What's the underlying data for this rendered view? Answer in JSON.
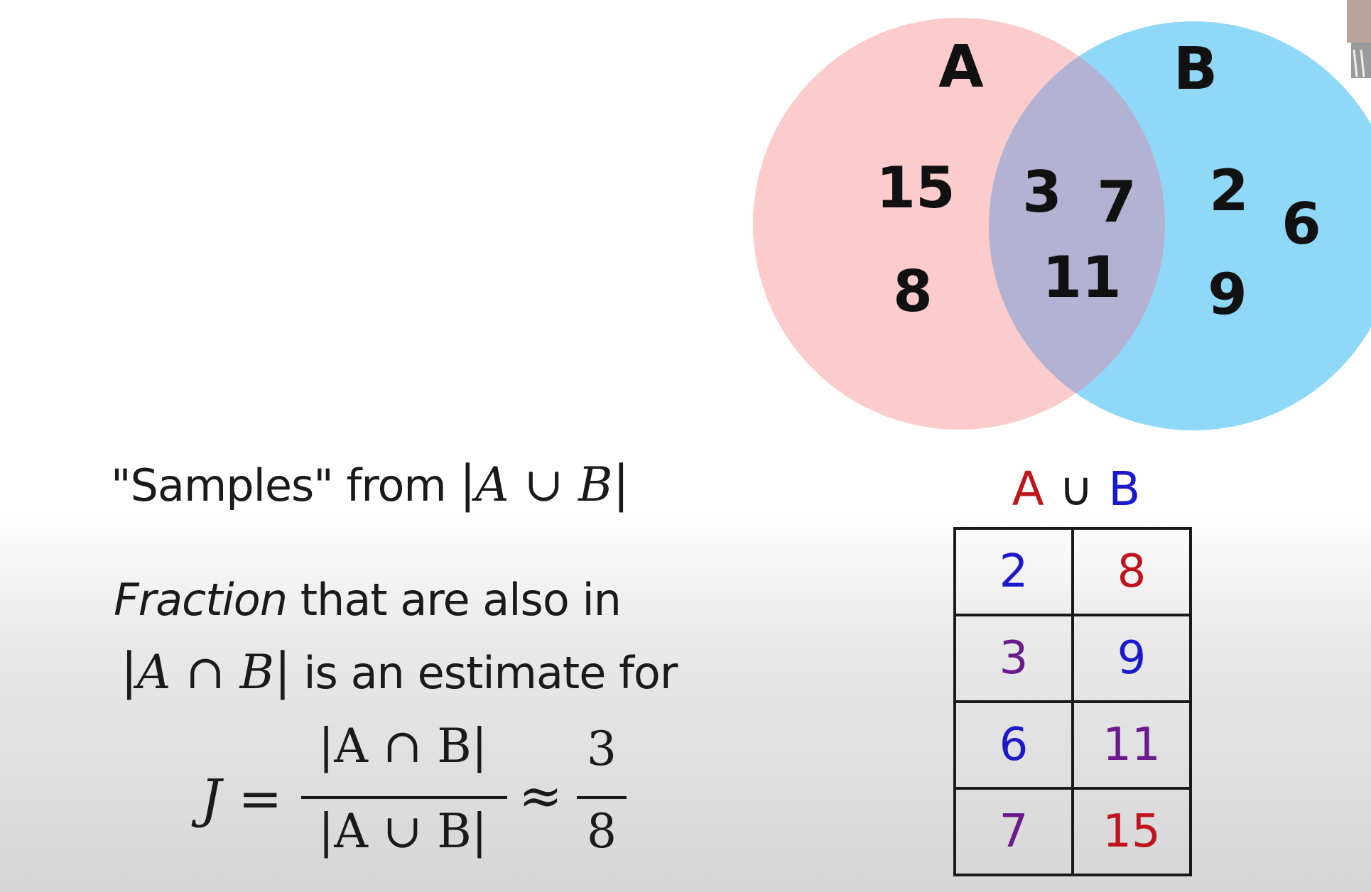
{
  "venn": {
    "set_a_label": "A",
    "set_b_label": "B",
    "set_a_color": "#fccbcb",
    "set_b_color": "#8fd8f7",
    "overlap_color": "#b4b2d2",
    "only_a": [
      "15",
      "8"
    ],
    "both": [
      "3",
      "7",
      "11"
    ],
    "only_b": [
      "2",
      "6",
      "9"
    ]
  },
  "text": {
    "samples_prefix": "\"Samples\" from ",
    "samples_math": "A ∪ B",
    "fraction_word": "Fraction",
    "fraction_rest": " that are also in",
    "intersection_math": "A ∩ B",
    "estimate_rest": " is an estimate for"
  },
  "formula": {
    "lhs": "J",
    "equals": "=",
    "numerator": "|A ∩ B|",
    "denominator": "|A ∪ B|",
    "approx": "≈",
    "estimate_numerator": "3",
    "estimate_denominator": "8"
  },
  "union_table": {
    "title_a": "A",
    "title_op": "∪",
    "title_b": "B",
    "colors": {
      "a_only": "#c0141c",
      "b_only": "#1a1acc",
      "both": "#6a1a8a",
      "label_op": "#1a1a1a"
    },
    "rows": [
      [
        {
          "value": "2",
          "set": "b_only"
        },
        {
          "value": "8",
          "set": "a_only"
        }
      ],
      [
        {
          "value": "3",
          "set": "both"
        },
        {
          "value": "9",
          "set": "b_only"
        }
      ],
      [
        {
          "value": "6",
          "set": "b_only"
        },
        {
          "value": "11",
          "set": "both"
        }
      ],
      [
        {
          "value": "7",
          "set": "both"
        },
        {
          "value": "15",
          "set": "a_only"
        }
      ]
    ]
  }
}
